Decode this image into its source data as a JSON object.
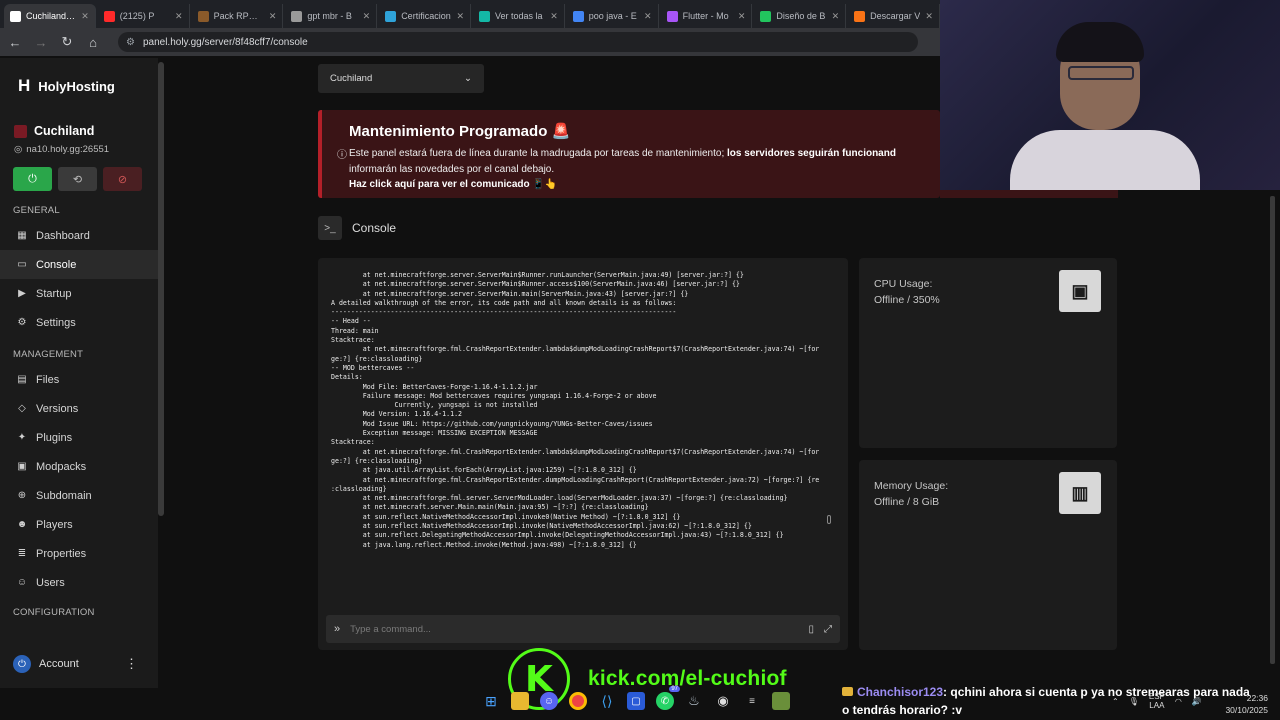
{
  "browser": {
    "tabs": [
      {
        "label": "Cuchiland | C",
        "color": "#ffffff",
        "active": true
      },
      {
        "label": "(2125) P",
        "color": "#ff2a2a",
        "active": false
      },
      {
        "label": "Pack RPG 1.",
        "color": "#8a5a2a",
        "active": false
      },
      {
        "label": "gpt mbr - B",
        "color": "#9a9a9a",
        "active": false
      },
      {
        "label": "Certificacion",
        "color": "#2fa3d9",
        "active": false
      },
      {
        "label": "Ver todas la",
        "color": "#14b8a6",
        "active": false
      },
      {
        "label": "poo java - E",
        "color": "#4285f4",
        "active": false
      },
      {
        "label": "Flutter - Mo",
        "color": "#a855f7",
        "active": false
      },
      {
        "label": "Diseño de B",
        "color": "#22c55e",
        "active": false
      },
      {
        "label": "Descargar V",
        "color": "#f97316",
        "active": false
      }
    ],
    "url": "panel.holy.gg/server/8f48cff7/console"
  },
  "sidebar": {
    "brand": "HolyHosting",
    "server_name": "Cuchiland",
    "server_address": "na10.holy.gg:26551",
    "sections": [
      {
        "title": "GENERAL",
        "items": [
          {
            "label": "Dashboard",
            "icon": "dashboard-icon",
            "glyph": "▦",
            "active": false
          },
          {
            "label": "Console",
            "icon": "console-icon",
            "glyph": "▭",
            "active": true
          },
          {
            "label": "Startup",
            "icon": "startup-icon",
            "glyph": "▶",
            "active": false
          },
          {
            "label": "Settings",
            "icon": "settings-icon",
            "glyph": "⚙",
            "active": false
          }
        ]
      },
      {
        "title": "MANAGEMENT",
        "items": [
          {
            "label": "Files",
            "icon": "files-icon",
            "glyph": "▤",
            "active": false
          },
          {
            "label": "Versions",
            "icon": "versions-icon",
            "glyph": "◇",
            "active": false
          },
          {
            "label": "Plugins",
            "icon": "plugins-icon",
            "glyph": "✦",
            "active": false
          },
          {
            "label": "Modpacks",
            "icon": "modpacks-icon",
            "glyph": "▣",
            "active": false
          },
          {
            "label": "Subdomain",
            "icon": "subdomain-icon",
            "glyph": "⊕",
            "active": false
          },
          {
            "label": "Players",
            "icon": "players-icon",
            "glyph": "☻",
            "active": false
          },
          {
            "label": "Properties",
            "icon": "properties-icon",
            "glyph": "≣",
            "active": false
          },
          {
            "label": "Users",
            "icon": "users-icon",
            "glyph": "☺",
            "active": false
          }
        ]
      },
      {
        "title": "CONFIGURATION",
        "items": []
      }
    ],
    "account": "Account"
  },
  "main": {
    "server_select": "Cuchiland",
    "banner": {
      "title": "Mantenimiento Programado",
      "body_plain": "Este panel estará fuera de línea durante la madrugada por tareas de mantenimiento; ",
      "body_bold": "los servidores seguirán funcionand",
      "body_rest": "informarán las novedades por el canal debajo.",
      "link": "Haz click aquí para ver el comunicado 📱👆"
    },
    "console_title": "Console",
    "console_lines": [
      "        at net.minecraftforge.server.ServerMain$Runner.runLauncher(ServerMain.java:49) [server.jar:?] {}",
      "        at net.minecraftforge.server.ServerMain$Runner.access$100(ServerMain.java:46) [server.jar:?] {}",
      "        at net.minecraftforge.server.ServerMain.main(ServerMain.java:43) [server.jar:?] {}",
      "A detailed walkthrough of the error, its code path and all known details is as follows:",
      "---------------------------------------------------------------------------------------",
      "-- Head --",
      "Thread: main",
      "Stacktrace:",
      "        at net.minecraftforge.fml.CrashReportExtender.lambda$dumpModLoadingCrashReport$7(CrashReportExtender.java:74) ~[for",
      "ge:?] {re:classloading}",
      "-- MOD bettercaves --",
      "Details:",
      "        Mod File: BetterCaves-Forge-1.16.4-1.1.2.jar",
      "        Failure message: Mod bettercaves requires yungsapi 1.16.4-Forge-2 or above",
      "                Currently, yungsapi is not installed",
      "        Mod Version: 1.16.4-1.1.2",
      "        Mod Issue URL: https://github.com/yungnickyoung/YUNGs-Better-Caves/issues",
      "        Exception message: MISSING EXCEPTION MESSAGE",
      "Stacktrace:",
      "        at net.minecraftforge.fml.CrashReportExtender.lambda$dumpModLoadingCrashReport$7(CrashReportExtender.java:74) ~[for",
      "ge:?] {re:classloading}",
      "        at java.util.ArrayList.forEach(ArrayList.java:1259) ~[?:1.8.0_312] {}",
      "        at net.minecraftforge.fml.CrashReportExtender.dumpModLoadingCrashReport(CrashReportExtender.java:72) ~[forge:?] {re",
      ":classloading}",
      "        at net.minecraftforge.fml.server.ServerModLoader.load(ServerModLoader.java:37) ~[forge:?] {re:classloading}",
      "        at net.minecraft.server.Main.main(Main.java:95) ~[?:?] {re:classloading}",
      "        at sun.reflect.NativeMethodAccessorImpl.invoke0(Native Method) ~[?:1.8.0_312] {}",
      "        at sun.reflect.NativeMethodAccessorImpl.invoke(NativeMethodAccessorImpl.java:62) ~[?:1.8.0_312] {}",
      "        at sun.reflect.DelegatingMethodAccessorImpl.invoke(DelegatingMethodAccessorImpl.java:43) ~[?:1.8.0_312] {}",
      "        at java.lang.reflect.Method.invoke(Method.java:498) ~[?:1.8.0_312] {}"
    ],
    "command_placeholder": "Type a command...",
    "cpu": {
      "label": "CPU Usage:",
      "value": "Offline / 350%"
    },
    "memory": {
      "label": "Memory Usage:",
      "value": "Offline / 8 GiB"
    }
  },
  "overlay": {
    "kick_logo": "K",
    "kick_url": "kick.com/el-cuchiof",
    "chat_user": "Chanchisor123",
    "chat_message": ": qchini ahora si cuenta p ya no stremearas para nada o tendrás horario? :v"
  },
  "taskbar": {
    "badge": "97",
    "lang_top": "ESP",
    "lang_bottom": "LAA",
    "time": "22:36",
    "date": "30/10/2025"
  }
}
